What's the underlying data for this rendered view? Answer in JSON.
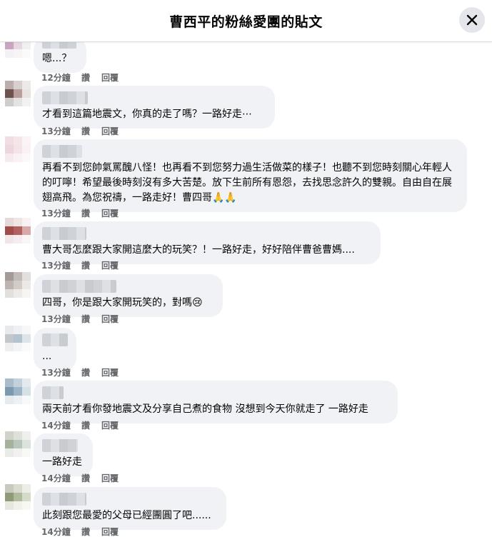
{
  "header": {
    "title": "曹西平的粉絲愛團的貼文",
    "close_icon": "close-icon"
  },
  "comments": [
    {
      "text": "嗯...？",
      "time": "12分鐘",
      "like": "讚",
      "reply": "回覆"
    },
    {
      "text": "才看到這篇地震文，你真的走了嗎？一路好走⋯",
      "time": "13分鐘",
      "like": "讚",
      "reply": "回覆"
    },
    {
      "text": "再看不到您帥氣罵醜八怪！也再看不到您努力過生活做菜的樣子！也聽不到您時刻關心年輕人的叮嚀！希望最後時刻沒有多大苦楚。放下生前所有恩怨，去找思念許久的雙親。自由自在展翅高飛。為您祝禱，一路走好！曹四哥🙏🙏",
      "time": "13分鐘",
      "like": "讚",
      "reply": "回覆"
    },
    {
      "text": "曹大哥怎麼跟大家開這麼大的玩笑？！一路好走，好好陪伴曹爸曹媽....",
      "time": "13分鐘",
      "like": "讚",
      "reply": "回覆"
    },
    {
      "text": "四哥，你是跟大家開玩笑的，對嗎😢",
      "time": "13分鐘",
      "like": "讚",
      "reply": "回覆"
    },
    {
      "text": "...",
      "time": "13分鐘",
      "like": "讚",
      "reply": "回覆"
    },
    {
      "text": "兩天前才看你發地震文及分享自己煮的食物 沒想到今天你就走了 一路好走",
      "time": "14分鐘",
      "like": "讚",
      "reply": "回覆"
    },
    {
      "text": "一路好走",
      "time": "14分鐘",
      "like": "讚",
      "reply": "回覆"
    },
    {
      "text": "此刻跟您最愛的父母已經團圓了吧......",
      "time": "14分鐘",
      "like": "讚",
      "reply": "回覆"
    }
  ],
  "colors": {
    "bubble": "#f0f2f5",
    "meta_text": "#65676b",
    "close_button_bg": "#e4e6eb"
  }
}
